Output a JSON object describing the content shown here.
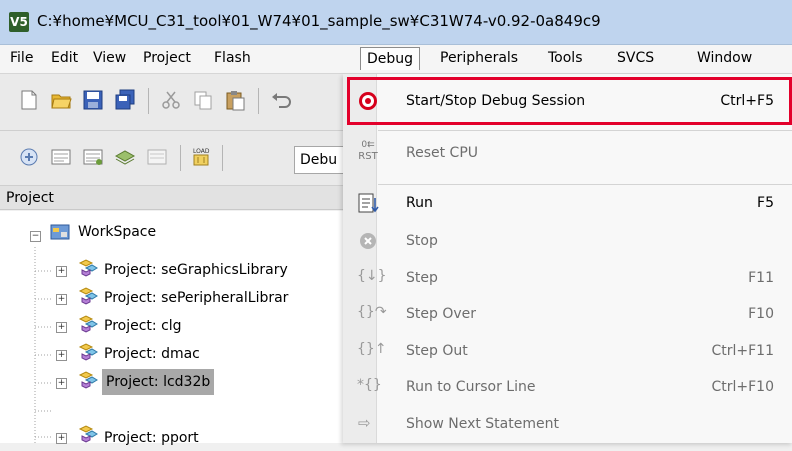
{
  "window": {
    "title": "C:¥home¥MCU_C31_tool¥01_W74¥01_sample_sw¥C31W74-v0.92-0a849c9",
    "app_icon": "V5"
  },
  "menubar": {
    "items": [
      "File",
      "Edit",
      "View",
      "Project",
      "Flash",
      "Debug",
      "Peripherals",
      "Tools",
      "SVCS",
      "Window"
    ],
    "active": "Debug"
  },
  "toolbar": {
    "config_combo": "Debu"
  },
  "project_pane": {
    "header": "Project",
    "workspace": "WorkSpace",
    "projects": [
      "Project: seGraphicsLibrary",
      "Project: sePeripheralLibrar",
      "Project: clg",
      "Project: dmac",
      "Project: lcd32b",
      "Project: pport"
    ],
    "selected_index": 4
  },
  "debug_menu": {
    "items": [
      {
        "label": "Start/Stop Debug Session",
        "shortcut": "Ctrl+F5",
        "icon": "debug-session-icon",
        "enabled": true
      },
      {
        "label": "Reset CPU",
        "shortcut": "",
        "icon": "reset-cpu-icon",
        "enabled": false
      },
      {
        "label": "Run",
        "shortcut": "F5",
        "icon": "run-icon",
        "enabled": true
      },
      {
        "label": "Stop",
        "shortcut": "",
        "icon": "stop-icon",
        "enabled": false
      },
      {
        "label": "Step",
        "shortcut": "F11",
        "icon": "step-icon",
        "enabled": false
      },
      {
        "label": "Step Over",
        "shortcut": "F10",
        "icon": "step-over-icon",
        "enabled": false
      },
      {
        "label": "Step Out",
        "shortcut": "Ctrl+F11",
        "icon": "step-out-icon",
        "enabled": false
      },
      {
        "label": "Run to Cursor Line",
        "shortcut": "Ctrl+F10",
        "icon": "run-to-cursor-icon",
        "enabled": false
      },
      {
        "label": "Show Next Statement",
        "shortcut": "",
        "icon": "show-next-statement-icon",
        "enabled": false
      }
    ],
    "reset_icon_text": "RST"
  },
  "colors": {
    "highlight_border": "#e3002b",
    "titlebar": "#bfd4ee",
    "selection": "#a8a8a8"
  }
}
